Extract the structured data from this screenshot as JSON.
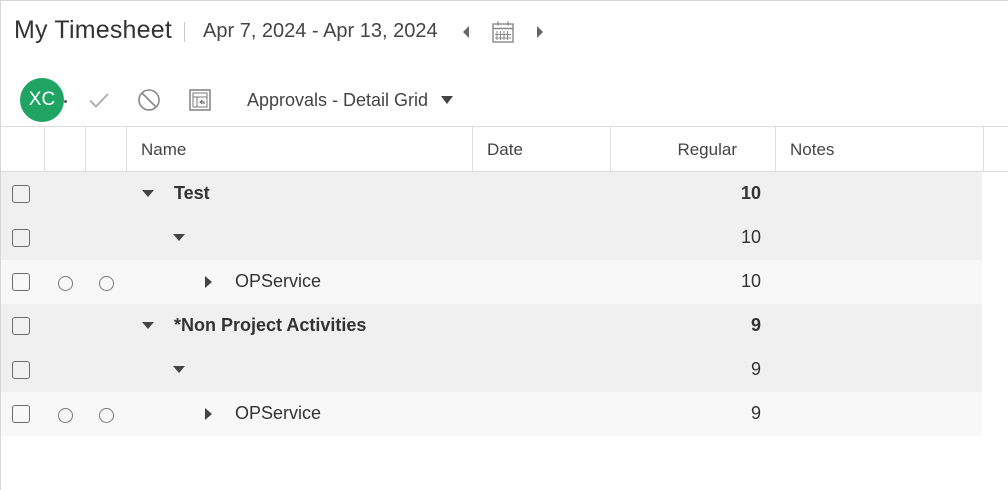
{
  "header": {
    "title": "My Timesheet",
    "date_range": "Apr 7, 2024 - Apr 13, 2024"
  },
  "toolbar": {
    "avatar_initials": "XC",
    "view_selector": "Approvals - Detail Grid"
  },
  "icons": {
    "prev": "chevron-left-icon",
    "calendar": "calendar-icon",
    "next": "chevron-right-icon",
    "approve": "check-icon",
    "reject": "block-icon",
    "grid": "grid-view-icon"
  },
  "colors": {
    "avatar": "#1fa463",
    "group_row": "#f0f0f0",
    "leaf_row": "#f8f8f8"
  },
  "grid": {
    "columns": {
      "name": "Name",
      "date": "Date",
      "regular": "Regular",
      "notes": "Notes"
    },
    "rows": [
      {
        "name": "Test",
        "regular": "10"
      },
      {
        "name": "",
        "regular": "10"
      },
      {
        "name": "OPService",
        "regular": "10"
      },
      {
        "name": "*Non Project Activities",
        "regular": "9"
      },
      {
        "name": "",
        "regular": "9"
      },
      {
        "name": "OPService",
        "regular": "9"
      }
    ]
  }
}
